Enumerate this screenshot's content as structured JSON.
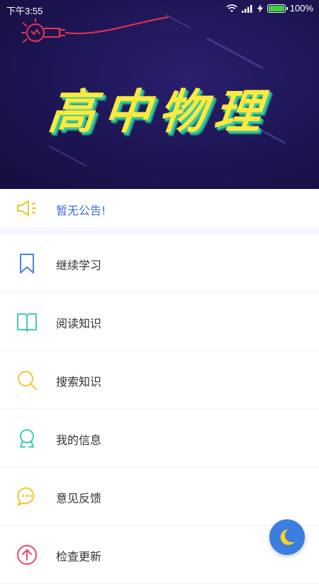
{
  "status_bar": {
    "time": "下午3:55",
    "battery": "100%"
  },
  "banner": {
    "title": "高中物理"
  },
  "notice": {
    "text": "暂无公告!"
  },
  "menu": {
    "items": [
      {
        "label": "继续学习",
        "icon": "bookmark-icon",
        "color": "#4a82e6"
      },
      {
        "label": "阅读知识",
        "icon": "open-book-icon",
        "color": "#3fcfb0"
      },
      {
        "label": "搜索知识",
        "icon": "search-icon",
        "color": "#f2c52e"
      },
      {
        "label": "我的信息",
        "icon": "user-icon",
        "color": "#3fcfb0"
      },
      {
        "label": "意见反馈",
        "icon": "chat-bubble-icon",
        "color": "#f2c52e"
      },
      {
        "label": "检查更新",
        "icon": "upload-arrow-icon",
        "color": "#e8486a"
      }
    ]
  },
  "night_mode_button": {
    "icon": "moon-icon",
    "color": "#3b7de0"
  }
}
